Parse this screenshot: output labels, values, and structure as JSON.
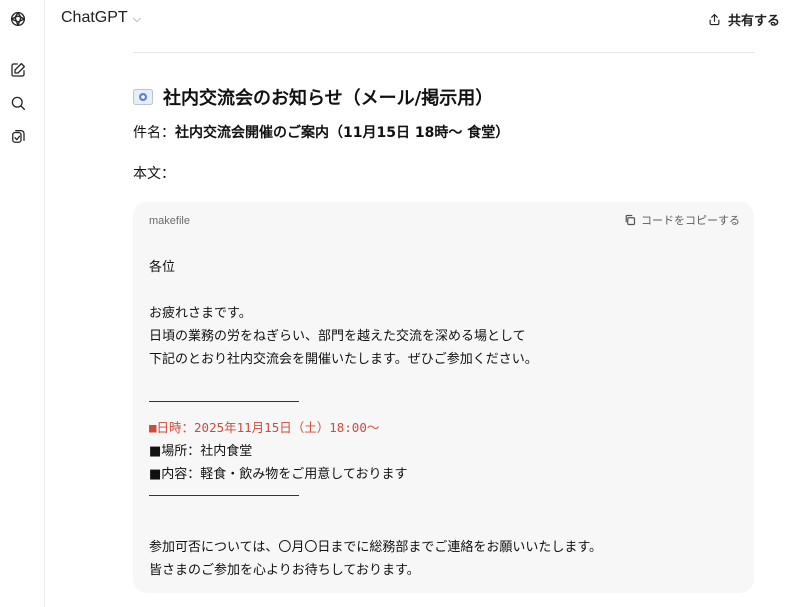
{
  "app": {
    "model_label": "ChatGPT",
    "share_label": "共有する"
  },
  "message": {
    "heading": "社内交流会のお知らせ（メール/掲示用）",
    "subject_prefix": "件名：",
    "subject_value": "社内交流会開催のご案内（11月15日 18時〜 食堂）",
    "body_label": "本文："
  },
  "code_block": {
    "language": "makefile",
    "copy_label": "コードをコピーする",
    "greeting": "各位",
    "intro_1": "お疲れさまです。",
    "intro_2": "日頃の業務の労をねぎらい、部門を越えた交流を深める場として",
    "intro_3": "下記のとおり社内交流会を開催いたします。ぜひご参加ください。",
    "datetime": "■日時：2025年11月15日（土）18:00〜",
    "location": "■場所：社内食堂",
    "content": "■内容：軽食・飲み物をご用意しております",
    "closing_1": "参加可否については、〇月〇日までに総務部までご連絡をお願いいたします。",
    "closing_2": "皆さまのご参加を心よりお待ちしております。"
  },
  "icons": {
    "logo": "openai-logo-icon",
    "new_chat": "edit-icon",
    "search": "search-icon",
    "library": "library-icon",
    "share": "share-icon",
    "copy": "copy-icon",
    "chevron": "chevron-down-icon",
    "envelope": "envelope-icon"
  },
  "colors": {
    "highlight": "#d14b3a",
    "code_bg": "#f7f7f8"
  }
}
